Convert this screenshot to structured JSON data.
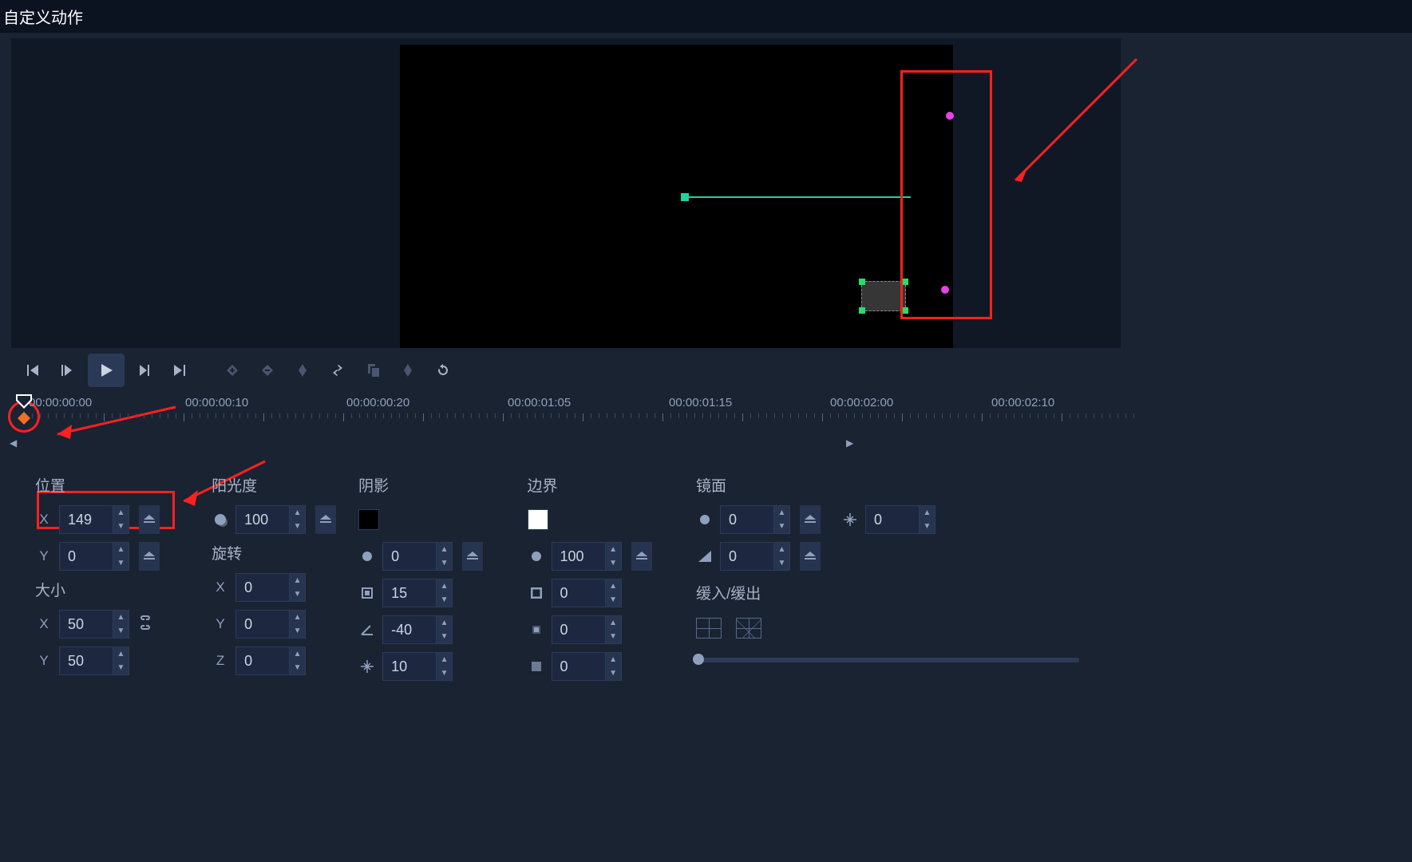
{
  "window": {
    "title": "自定义动作"
  },
  "timeline": {
    "labels": [
      "00:00:00:00",
      "00:00:00:10",
      "00:00:00:20",
      "00:00:01:05",
      "00:00:01:15",
      "00:00:02:00",
      "00:00:02:10"
    ]
  },
  "props": {
    "position": {
      "label": "位置",
      "x_label": "X",
      "y_label": "Y",
      "x": "149",
      "y": "0"
    },
    "size": {
      "label": "大小",
      "x_label": "X",
      "y_label": "Y",
      "x": "50",
      "y": "50"
    },
    "opacity": {
      "label": "阳光度",
      "value": "100"
    },
    "rotation": {
      "label": "旋转",
      "x_label": "X",
      "y_label": "Y",
      "z_label": "Z",
      "x": "0",
      "y": "0",
      "z": "0"
    },
    "shadow": {
      "label": "阴影",
      "color": "#000000",
      "opacity": "0",
      "blur": "15",
      "angle": "-40",
      "distance": "10"
    },
    "border": {
      "label": "边界",
      "color": "#ffffff",
      "opacity": "100",
      "width": "0",
      "feather": "0",
      "radius": "0"
    },
    "mirror": {
      "label": "镜面",
      "opacity": "0",
      "offset": "0",
      "distance": "0"
    },
    "ease": {
      "label": "缓入/缓出"
    }
  }
}
